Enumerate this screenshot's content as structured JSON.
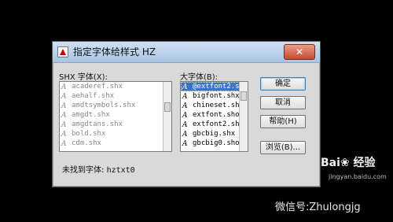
{
  "dialog": {
    "title": "指定字体给样式 HZ",
    "close_label": "✕",
    "shx_label": "SHX 字体(X):",
    "big_label": "大字体(B):",
    "shx_fonts": [
      "acaderef.shx",
      "aehalf.shx",
      "amdtsymbols.shx",
      "amgdt.shx",
      "amgdtans.shx",
      "bold.shx",
      "cdm.shx"
    ],
    "big_fonts": [
      "@extfont2.sl",
      "bigfont.shx",
      "chineset.sh",
      "extfont.sho",
      "extfont2.sh",
      "gbcbig.shx",
      "gbcbig0.sho"
    ],
    "buttons": {
      "ok": "确定",
      "cancel": "取消",
      "help": "帮助(H)",
      "browse": "浏览(B)..."
    },
    "status_prefix": "未找到字体:",
    "status_value": "hztxt0"
  },
  "watermark": {
    "brand": "Bai❀ 经验",
    "url": "jingyan.baidu.com",
    "wechat": "微信号:Zhulongjg"
  },
  "colors": {
    "selection": "#3a73c8",
    "dialog_bg": "#d9d9d9"
  }
}
